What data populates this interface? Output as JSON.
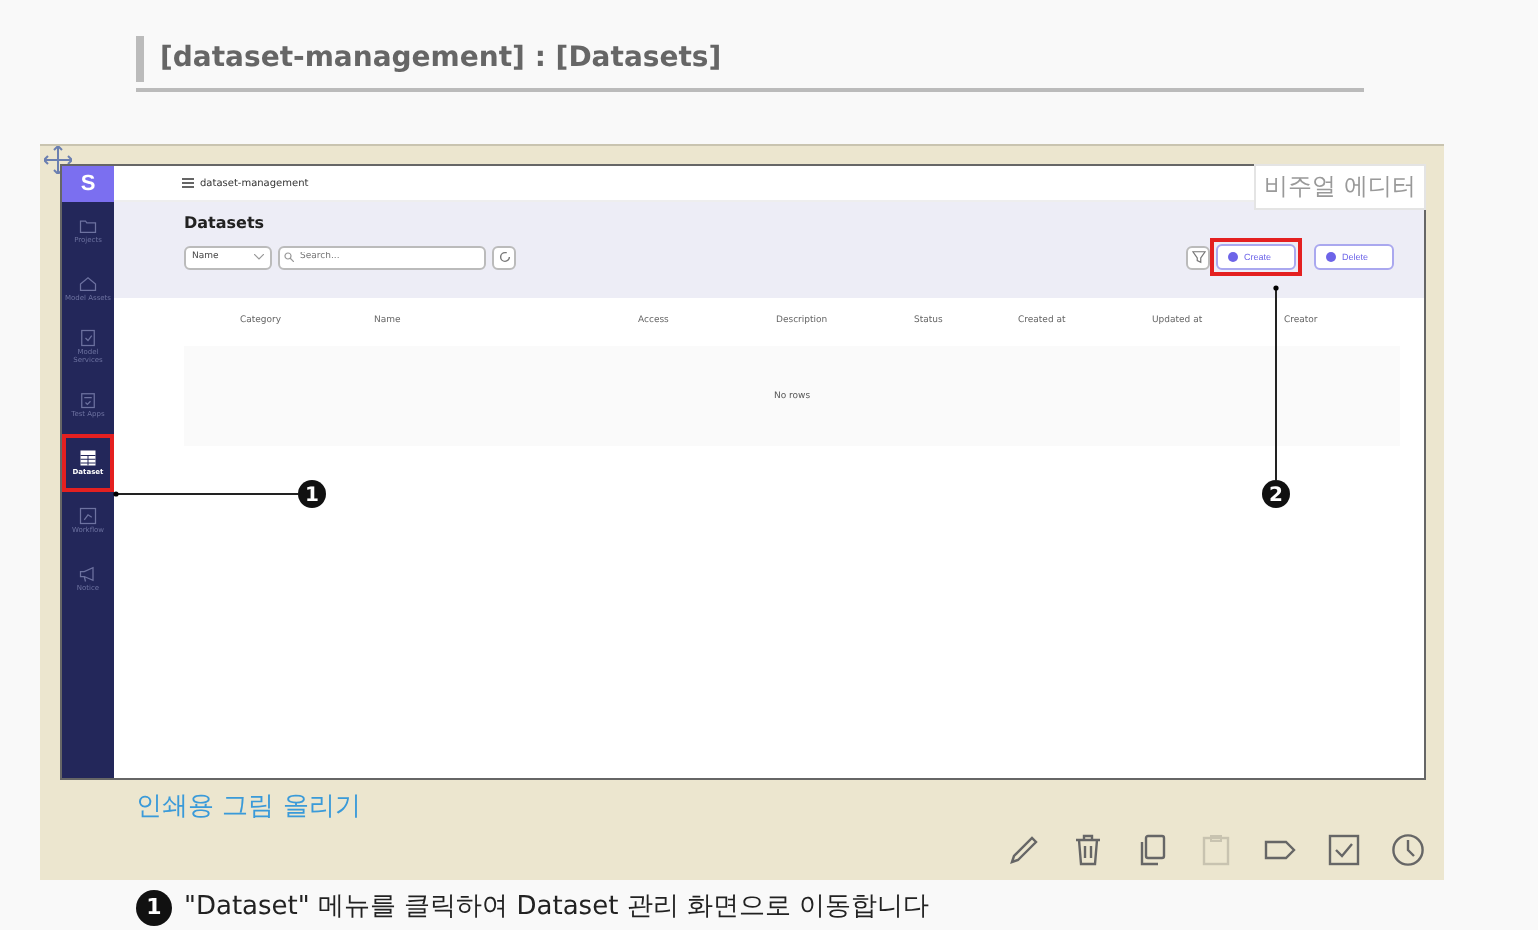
{
  "heading": "[dataset-management] : [Datasets]",
  "editor": {
    "badge": "비주얼 에디터",
    "print_link": "인쇄용 그림 올리기"
  },
  "app": {
    "logo": "S",
    "breadcrumb": "dataset-management",
    "sidebar": [
      {
        "kind": "folder",
        "label": "Projects",
        "selected": false,
        "highlighted": false
      },
      {
        "kind": "house",
        "label": "Model Assets",
        "selected": false,
        "highlighted": false
      },
      {
        "kind": "doc",
        "label": "Model Services",
        "selected": false,
        "highlighted": false
      },
      {
        "kind": "clipboard",
        "label": "Test Apps",
        "selected": false,
        "highlighted": false
      },
      {
        "kind": "table",
        "label": "Dataset",
        "selected": true,
        "highlighted": true
      },
      {
        "kind": "chart",
        "label": "Workflow",
        "selected": false,
        "highlighted": false
      },
      {
        "kind": "megaphone",
        "label": "Notice",
        "selected": false,
        "highlighted": false
      }
    ],
    "page_title": "Datasets",
    "filter_select": "Name",
    "search": {
      "placeholder": "Search..."
    },
    "buttons": [
      {
        "label": "Create",
        "highlighted": true
      },
      {
        "label": "Delete",
        "highlighted": false
      }
    ],
    "columns": [
      "Category",
      "Name",
      "Access",
      "Description",
      "Status",
      "Created at",
      "Updated at",
      "Creator"
    ],
    "empty_text": "No rows"
  },
  "callouts": [
    {
      "number": "1"
    },
    {
      "number": "2"
    }
  ],
  "toolbar": [
    {
      "kind": "pencil",
      "disabled": false
    },
    {
      "kind": "trash",
      "disabled": false
    },
    {
      "kind": "copy",
      "disabled": false
    },
    {
      "kind": "clipboard",
      "disabled": true
    },
    {
      "kind": "tag",
      "disabled": false
    },
    {
      "kind": "checkbox",
      "disabled": false
    },
    {
      "kind": "clock",
      "disabled": false
    }
  ],
  "notes": [
    {
      "number": "1",
      "text": "\"Dataset\" 메뉴를 클릭하여 Dataset 관리 화면으로 이동합니다"
    }
  ]
}
